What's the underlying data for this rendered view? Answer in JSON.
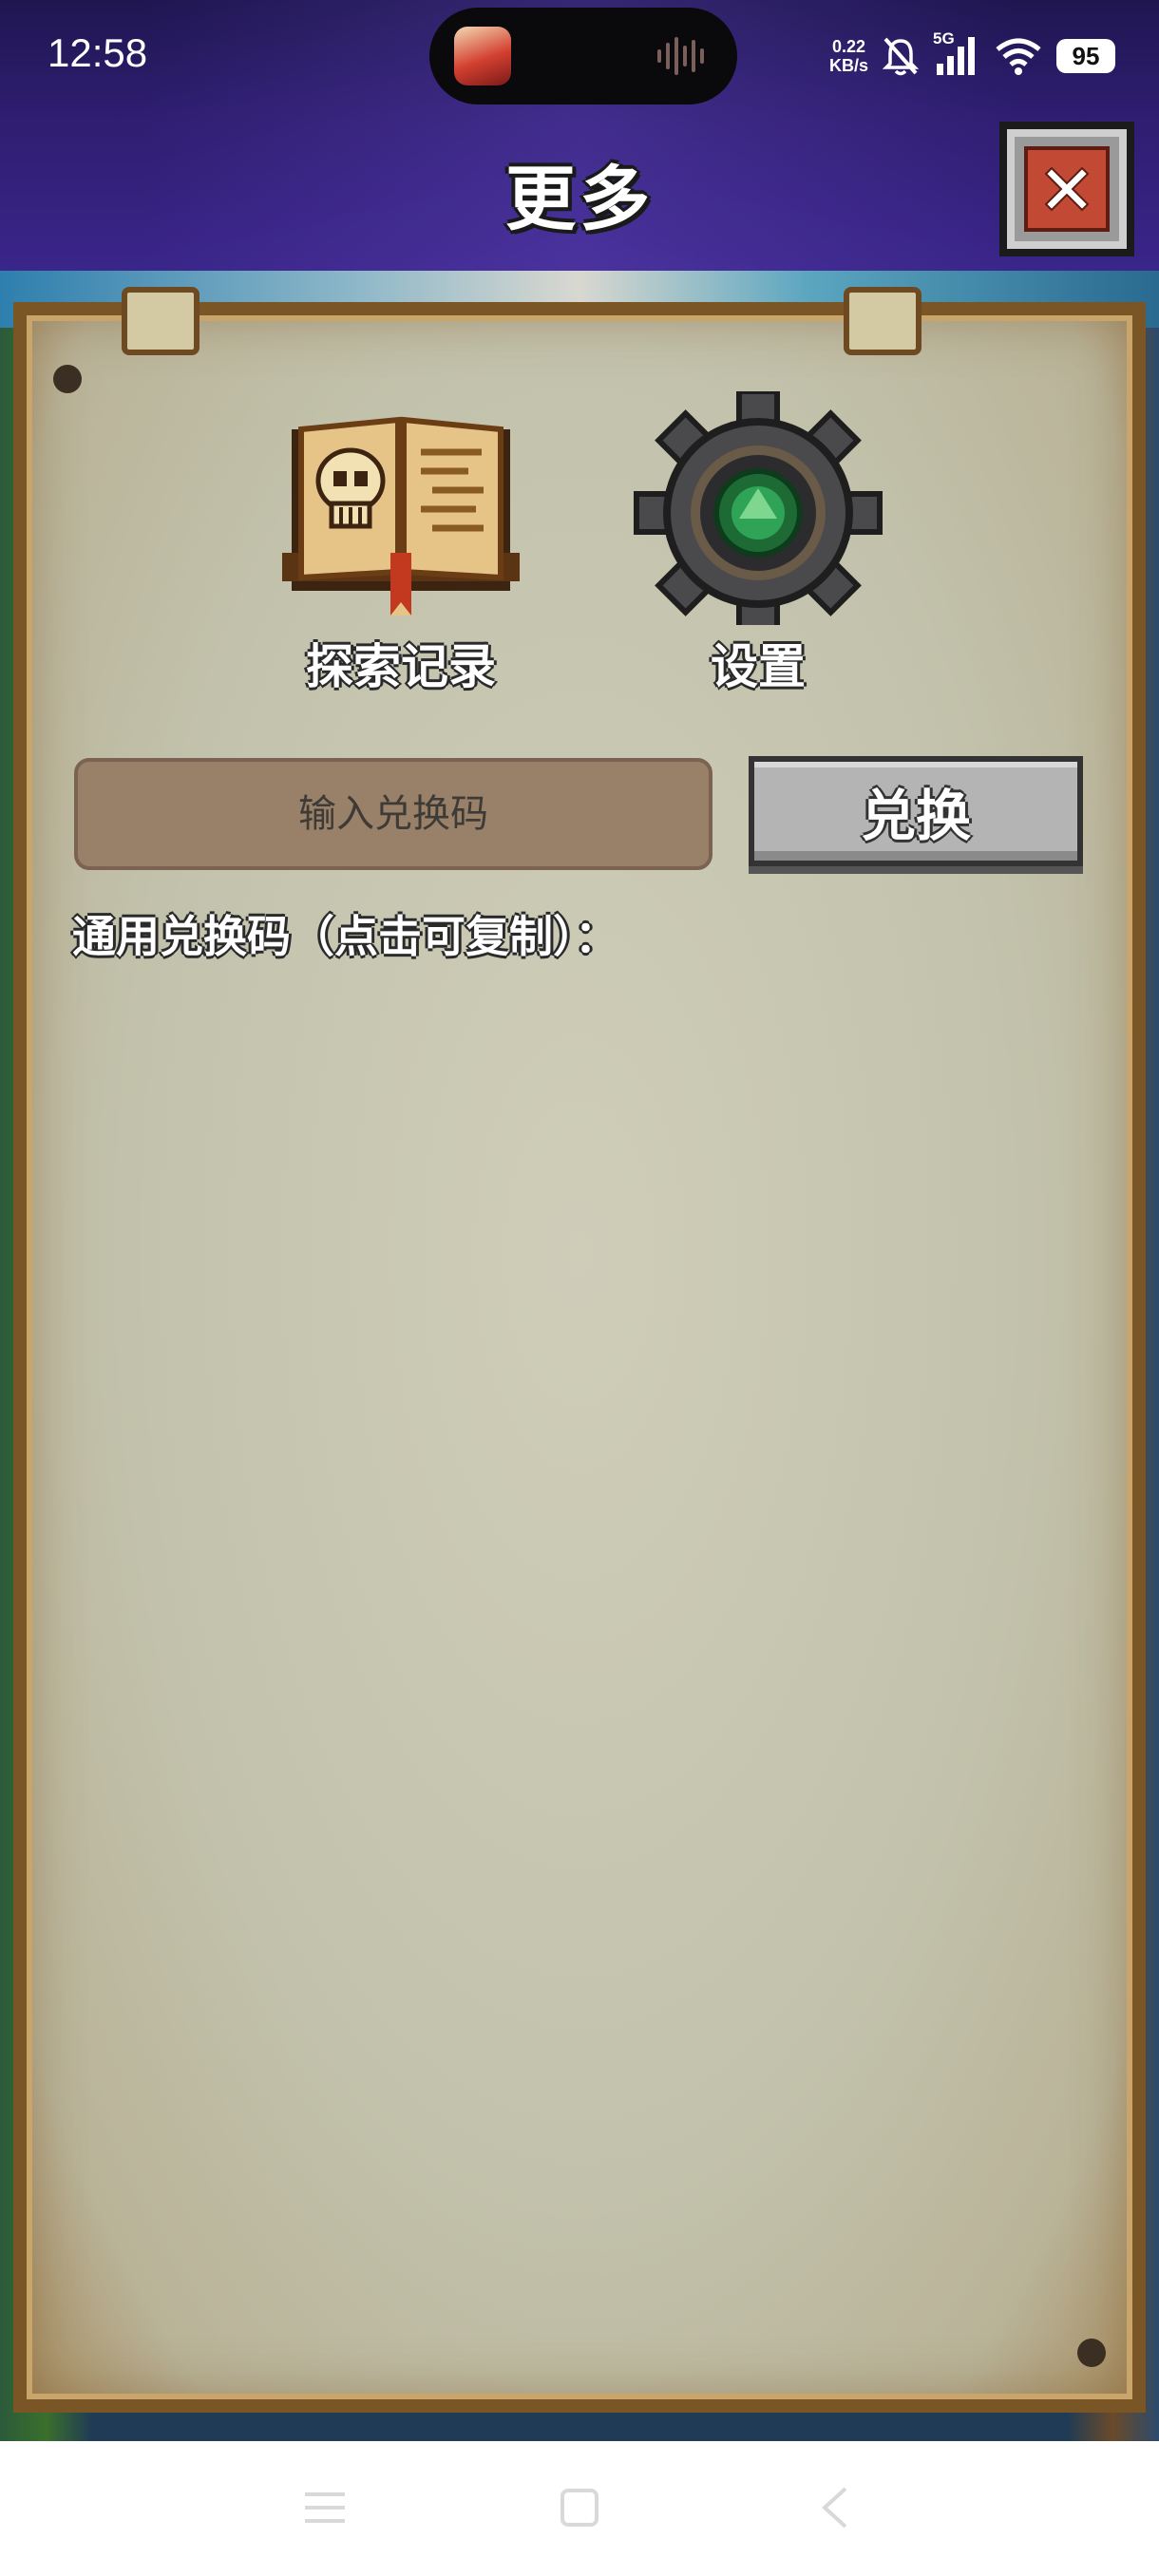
{
  "status_bar": {
    "time": "12:58",
    "net_speed_value": "0.22",
    "net_speed_unit": "KB/s",
    "network_type": "5G",
    "battery": "95"
  },
  "header": {
    "title": "更多"
  },
  "menu": {
    "items": [
      {
        "label": "探索记录",
        "icon": "skull-book-icon"
      },
      {
        "label": "设置",
        "icon": "gear-icon"
      }
    ]
  },
  "redeem": {
    "placeholder": "输入兑换码",
    "button_label": "兑换",
    "codes_label": "通用兑换码（点击可复制）："
  },
  "colors": {
    "header_bg": "#2f1e72",
    "parchment": "#c3c3ad",
    "input_bg": "#998068",
    "button_bg": "#b4b4b4",
    "close_red": "#c24a34"
  }
}
